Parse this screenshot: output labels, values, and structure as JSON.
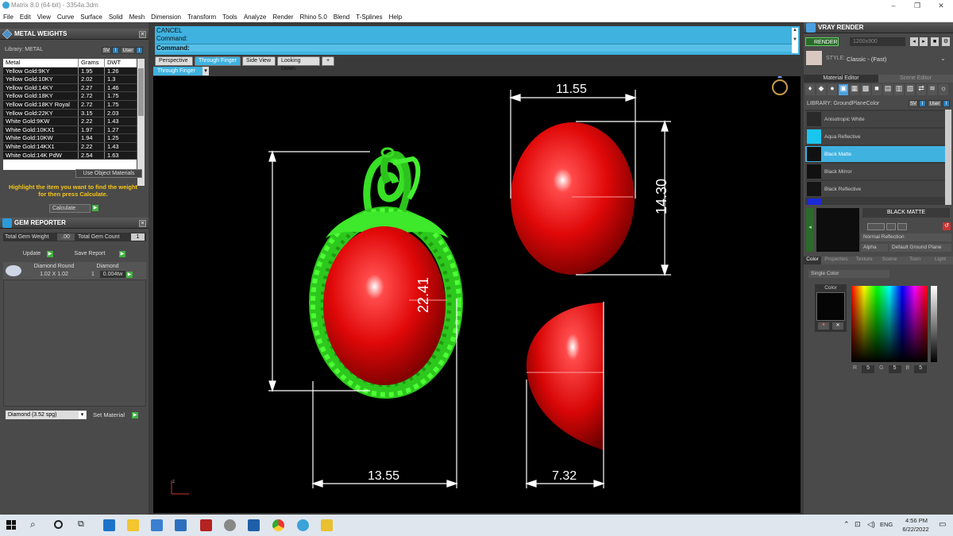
{
  "window": {
    "title": "Matrix 8.0 (64-bit) - 3354a.3dm",
    "min": "–",
    "max": "❐",
    "close": "✕"
  },
  "menu": [
    "File",
    "Edit",
    "View",
    "Curve",
    "Surface",
    "Solid",
    "Mesh",
    "Dimension",
    "Transform",
    "Tools",
    "Analyze",
    "Render",
    "Rhino 5.0",
    "Blend",
    "T-Splines",
    "Help"
  ],
  "metal_weights": {
    "title": "METAL WEIGHTS",
    "library_label": "Library: METAL",
    "columns": [
      "Metal",
      "Grams",
      "DWT"
    ],
    "rows": [
      [
        "Yellow Gold:9KY",
        "1.95",
        "1.26"
      ],
      [
        "Yellow Gold:10KY",
        "2.02",
        "1.3"
      ],
      [
        "Yellow Gold:14KY",
        "2.27",
        "1.46"
      ],
      [
        "Yellow Gold:18KY",
        "2.72",
        "1.75"
      ],
      [
        "Yellow Gold:18KY Royal",
        "2.72",
        "1.75"
      ],
      [
        "Yellow Gold:22KY",
        "3.15",
        "2.03"
      ],
      [
        "White Gold:9KW",
        "2.22",
        "1.43"
      ],
      [
        "White Gold:10KX1",
        "1.97",
        "1.27"
      ],
      [
        "White Gold:10KW",
        "1.94",
        "1.25"
      ],
      [
        "White Gold:14KX1",
        "2.22",
        "1.43"
      ],
      [
        "White Gold:14K PdW",
        "2.54",
        "1.63"
      ]
    ],
    "use_object_materials": "Use Object Materials",
    "hint": "Highlight the item you want to find the weight for then press Calculate.",
    "calculate": "Calculate"
  },
  "gem_reporter": {
    "title": "GEM REPORTER",
    "total_gem_weight_label": "Total Gem Weight",
    "total_gem_weight": ".00",
    "total_gem_count_label": "Total Gem Count",
    "total_gem_count": "1",
    "update": "Update",
    "save_report": "Save Report",
    "gem_name": "Diamond Round",
    "gem_size": "1.02 X 1.02",
    "gem_type": "Diamond",
    "gem_qty": "1",
    "gem_weight": "0.004tw",
    "material_select": "Diamond    (3.52 spg)",
    "set_material": "Set Material"
  },
  "command": {
    "line1": "CANCEL",
    "line2": "Command:",
    "line3": "Command:"
  },
  "tabs": [
    "Perspective",
    "Through Finger",
    "Side View",
    "Looking Down",
    "+"
  ],
  "active_view": "Through Finger",
  "dimensions": {
    "height_left": "22.41",
    "width_left": "13.55",
    "width_top": "11.55",
    "height_right": "14.30",
    "width_bottom": "7.32"
  },
  "vray": {
    "title": "VRAY RENDER",
    "render": "RENDER",
    "resolution": "1200x900",
    "style_label": "STYLE:",
    "style": "Classic - (Fast)",
    "tab_material": "Material Editor",
    "tab_scene": "Scene Editor",
    "library": "LIBRARY: GroundPlaneColor",
    "materials": [
      "Anisotropic White",
      "Aqua Reflective",
      "Black Matte",
      "Black Mirror",
      "Black Reflective"
    ],
    "selected_material": "BLACK MATTE",
    "reflection": "Normal Reflection",
    "alpha": "Alpha",
    "ground": "Default Ground Plane",
    "subtabs": [
      "Color",
      "Properties",
      "Texture",
      "Scene",
      "Toon",
      "Light"
    ],
    "color_mode": "Single Color",
    "color_label": "Color",
    "rgb": [
      "5",
      "5",
      "5"
    ]
  },
  "taskbar": {
    "lang": "ENG",
    "time": "4:56 PM",
    "date": "6/22/2022"
  },
  "colors": {
    "accent": "#3fb2e0",
    "stone": "#e81010",
    "metal": "#33dd22"
  }
}
